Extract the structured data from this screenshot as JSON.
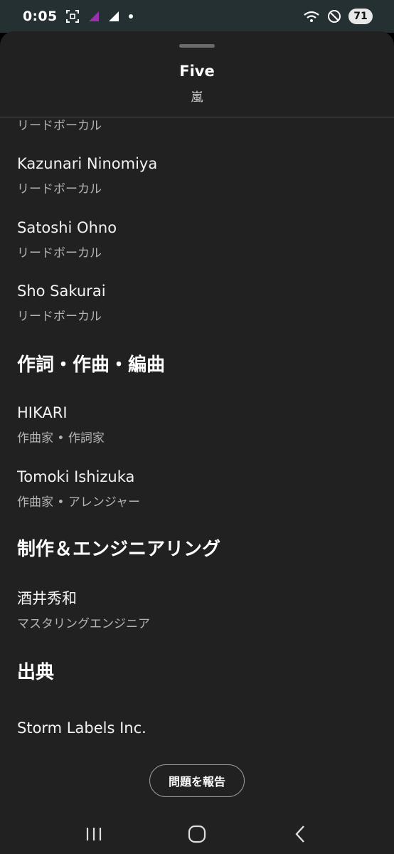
{
  "status_bar": {
    "time": "0:05",
    "battery": "71",
    "icons": [
      "screenshot-icon",
      "signal-purple-icon",
      "signal-white-icon",
      "dot-icon",
      "wifi-icon",
      "do-not-disturb-icon",
      "battery-icon"
    ]
  },
  "sheet": {
    "title": "Five",
    "subtitle": "嵐"
  },
  "top_partial_role": "リードボーカル",
  "performers": [
    {
      "name": "Kazunari Ninomiya",
      "role": "リードボーカル"
    },
    {
      "name": "Satoshi Ohno",
      "role": "リードボーカル"
    },
    {
      "name": "Sho Sakurai",
      "role": "リードボーカル"
    }
  ],
  "sections": {
    "writing": {
      "heading": "作詞・作曲・編曲",
      "items": [
        {
          "name": "HIKARI",
          "role": "作曲家 • 作詞家"
        },
        {
          "name": "Tomoki Ishizuka",
          "role": "作曲家 • アレンジャー"
        }
      ]
    },
    "production": {
      "heading": "制作＆エンジニアリング",
      "items": [
        {
          "name": "酒井秀和",
          "role": "マスタリングエンジニア"
        }
      ]
    },
    "source": {
      "heading": "出典",
      "items": [
        {
          "name": "Storm Labels Inc."
        }
      ]
    }
  },
  "report_button": "問題を報告",
  "colors": {
    "status_bar_bg": "#253033",
    "sheet_bg": "#212121",
    "secondary_text": "#b3b3b3"
  }
}
